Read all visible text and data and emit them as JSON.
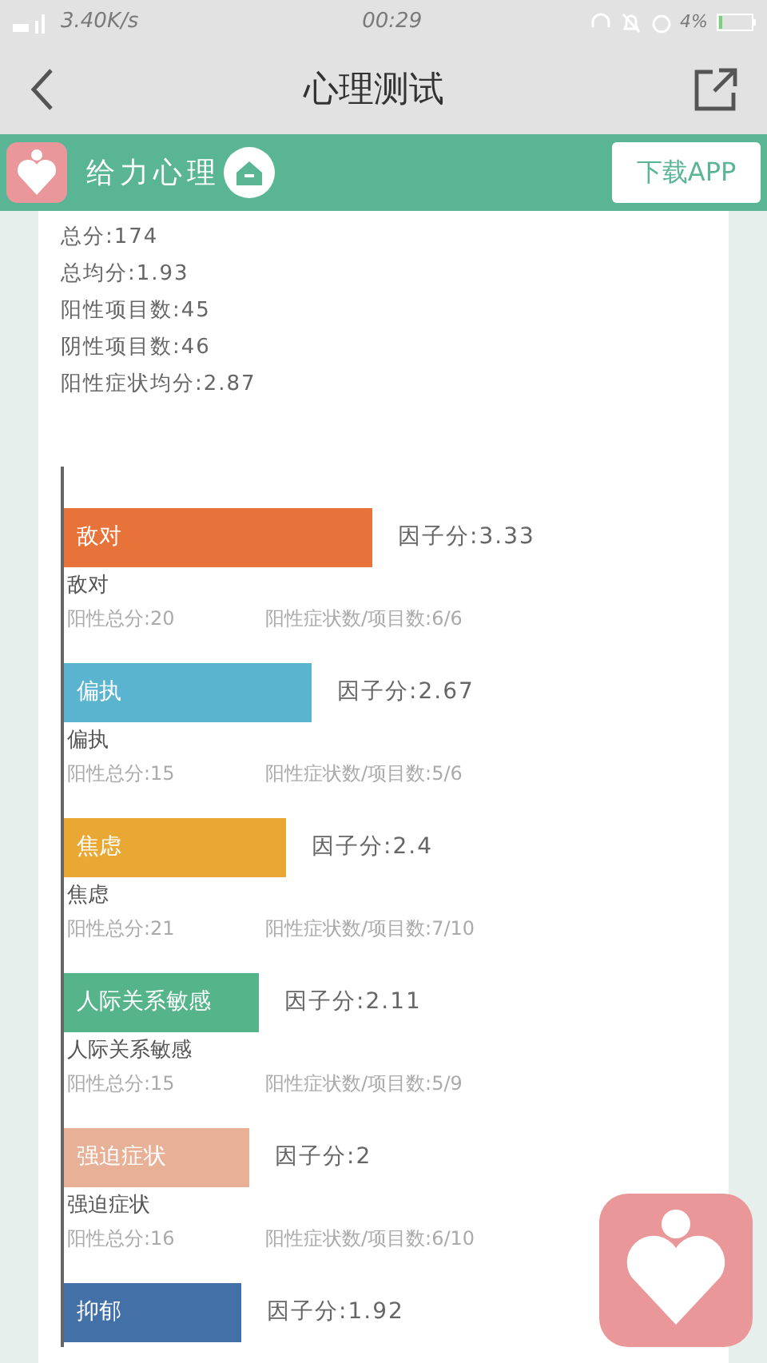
{
  "status_bar": {
    "speed": "3.40K/s",
    "time": "00:29",
    "battery": "4%"
  },
  "nav": {
    "title": "心理测试"
  },
  "banner": {
    "brand": "给力心理",
    "download": "下载APP"
  },
  "summary": [
    "总分:174",
    "总均分:1.93",
    "阳性项目数:45",
    "阴性项目数:46",
    "阳性症状均分:2.87"
  ],
  "factors": [
    {
      "name": "敌对",
      "color": "#e8733a",
      "score": "因子分:3.33",
      "caption": "敌对",
      "positive_total": "阳性总分:20",
      "ratio": "阳性症状数/项目数:6/6"
    },
    {
      "name": "偏执",
      "color": "#5ab4d0",
      "score": "因子分:2.67",
      "caption": "偏执",
      "positive_total": "阳性总分:15",
      "ratio": "阳性症状数/项目数:5/6"
    },
    {
      "name": "焦虑",
      "color": "#e8a833",
      "score": "因子分:2.4",
      "caption": "焦虑",
      "positive_total": "阳性总分:21",
      "ratio": "阳性症状数/项目数:7/10"
    },
    {
      "name": "人际关系敏感",
      "color": "#55b48a",
      "score": "因子分:2.11",
      "caption": "人际关系敏感",
      "positive_total": "阳性总分:15",
      "ratio": "阳性症状数/项目数:5/9"
    },
    {
      "name": "强迫症状",
      "color": "#e8b096",
      "score": "因子分:2",
      "caption": "强迫症状",
      "positive_total": "阳性总分:16",
      "ratio": "阳性症状数/项目数:6/10"
    },
    {
      "name": "抑郁",
      "color": "#4470a8",
      "score": "因子分:1.92"
    }
  ]
}
